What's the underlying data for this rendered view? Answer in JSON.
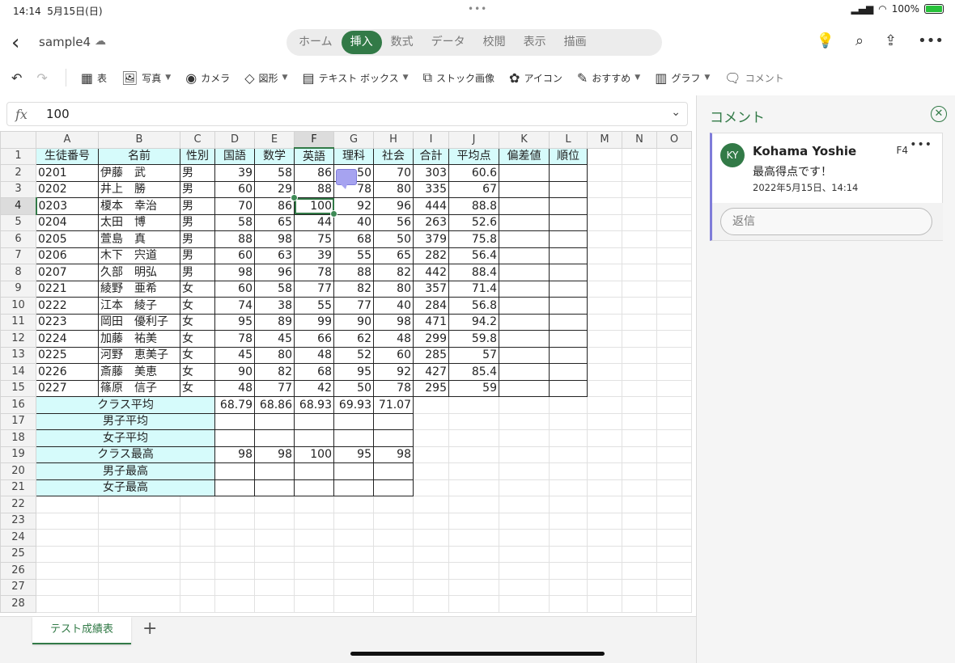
{
  "status_bar": {
    "time": "14:14",
    "date": "5月15日(日)",
    "battery": "100%"
  },
  "app": {
    "file_name": "sample4"
  },
  "tabs": [
    "ホーム",
    "挿入",
    "数式",
    "データ",
    "校閲",
    "表示",
    "描画"
  ],
  "active_tab": "挿入",
  "ribbon": {
    "table": "表",
    "photo": "写真",
    "camera": "カメラ",
    "shape": "図形",
    "textbox": "テキスト ボックス",
    "stock": "ストック画像",
    "icon": "アイコン",
    "recommended": "おすすめ",
    "chart": "グラフ",
    "comment": "コメント"
  },
  "formula_bar": {
    "fx": "fx",
    "value": "100"
  },
  "columns": [
    "A",
    "B",
    "C",
    "D",
    "E",
    "F",
    "G",
    "H",
    "I",
    "J",
    "K",
    "L",
    "M",
    "N",
    "O"
  ],
  "headers": [
    "生徒番号",
    "名前",
    "性別",
    "国語",
    "数学",
    "英語",
    "理科",
    "社会",
    "合計",
    "平均点",
    "偏差値",
    "順位"
  ],
  "students": [
    [
      "0201",
      "伊藤　武",
      "男",
      "39",
      "58",
      "86",
      "50",
      "70",
      "303",
      "60.6"
    ],
    [
      "0202",
      "井上　勝",
      "男",
      "60",
      "29",
      "88",
      "78",
      "80",
      "335",
      "67"
    ],
    [
      "0203",
      "榎本　幸治",
      "男",
      "70",
      "86",
      "100",
      "92",
      "96",
      "444",
      "88.8"
    ],
    [
      "0204",
      "太田　博",
      "男",
      "58",
      "65",
      "44",
      "40",
      "56",
      "263",
      "52.6"
    ],
    [
      "0205",
      "萱島　真",
      "男",
      "88",
      "98",
      "75",
      "68",
      "50",
      "379",
      "75.8"
    ],
    [
      "0206",
      "木下　宍道",
      "男",
      "60",
      "63",
      "39",
      "55",
      "65",
      "282",
      "56.4"
    ],
    [
      "0207",
      "久部　明弘",
      "男",
      "98",
      "96",
      "78",
      "88",
      "82",
      "442",
      "88.4"
    ],
    [
      "0221",
      "綾野　亜希",
      "女",
      "60",
      "58",
      "77",
      "82",
      "80",
      "357",
      "71.4"
    ],
    [
      "0222",
      "江本　綾子",
      "女",
      "74",
      "38",
      "55",
      "77",
      "40",
      "284",
      "56.8"
    ],
    [
      "0223",
      "岡田　優利子",
      "女",
      "95",
      "89",
      "99",
      "90",
      "98",
      "471",
      "94.2"
    ],
    [
      "0224",
      "加藤　祐美",
      "女",
      "78",
      "45",
      "66",
      "62",
      "48",
      "299",
      "59.8"
    ],
    [
      "0225",
      "河野　恵美子",
      "女",
      "45",
      "80",
      "48",
      "52",
      "60",
      "285",
      "57"
    ],
    [
      "0226",
      "斎藤　美恵",
      "女",
      "90",
      "82",
      "68",
      "95",
      "92",
      "427",
      "85.4"
    ],
    [
      "0227",
      "篠原　信子",
      "女",
      "48",
      "77",
      "42",
      "50",
      "78",
      "295",
      "59"
    ]
  ],
  "summary": [
    {
      "label": "クラス平均",
      "values": [
        "68.79",
        "68.86",
        "68.93",
        "69.93",
        "71.07"
      ]
    },
    {
      "label": "男子平均",
      "values": [
        "",
        "",
        "",
        "",
        ""
      ]
    },
    {
      "label": "女子平均",
      "values": [
        "",
        "",
        "",
        "",
        ""
      ]
    },
    {
      "label": "クラス最高",
      "values": [
        "98",
        "98",
        "100",
        "95",
        "98"
      ]
    },
    {
      "label": "男子最高",
      "values": [
        "",
        "",
        "",
        "",
        ""
      ]
    },
    {
      "label": "女子最高",
      "values": [
        "",
        "",
        "",
        "",
        ""
      ]
    }
  ],
  "row_count": 28,
  "selected_cell": "F4",
  "sheet_tab": "テスト成績表",
  "comments_pane": {
    "title": "コメント",
    "avatar": "KY",
    "author": "Kohama Yoshie",
    "cell": "F4",
    "text": "最高得点です！",
    "date": "2022年5月15日、14:14",
    "reply_placeholder": "返信"
  },
  "colors": {
    "accent": "#327a47",
    "header_fill": "#d6fbfb",
    "comment_marker": "#a6a3f0"
  }
}
